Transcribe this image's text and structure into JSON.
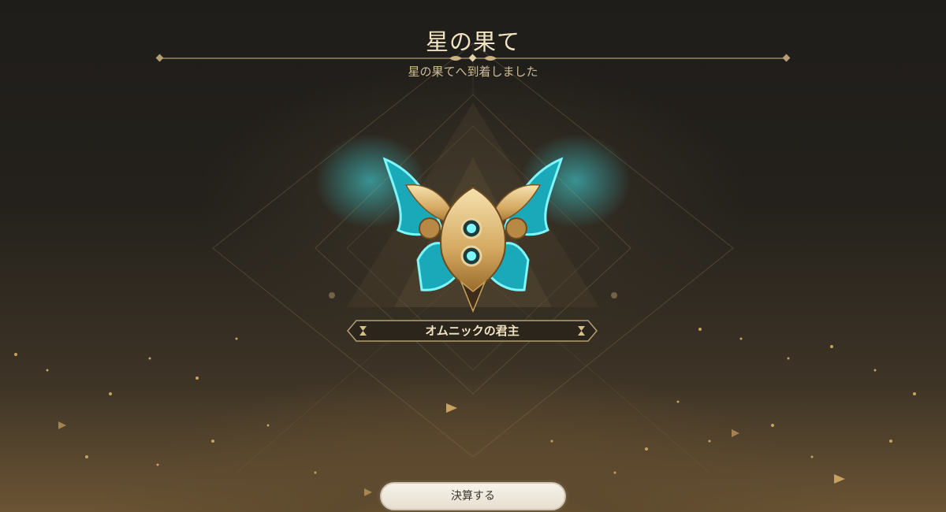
{
  "header": {
    "title": "星の果て",
    "subtitle": "星の果てへ到着しました"
  },
  "reward": {
    "emblem_icon": "winged-emblem-icon",
    "name": "オムニックの君主"
  },
  "footer": {
    "settle_label": "決算する"
  },
  "colors": {
    "gold": "#d8bf8a",
    "cyan": "#3fe6ee",
    "title_text": "#f1e2c1"
  }
}
